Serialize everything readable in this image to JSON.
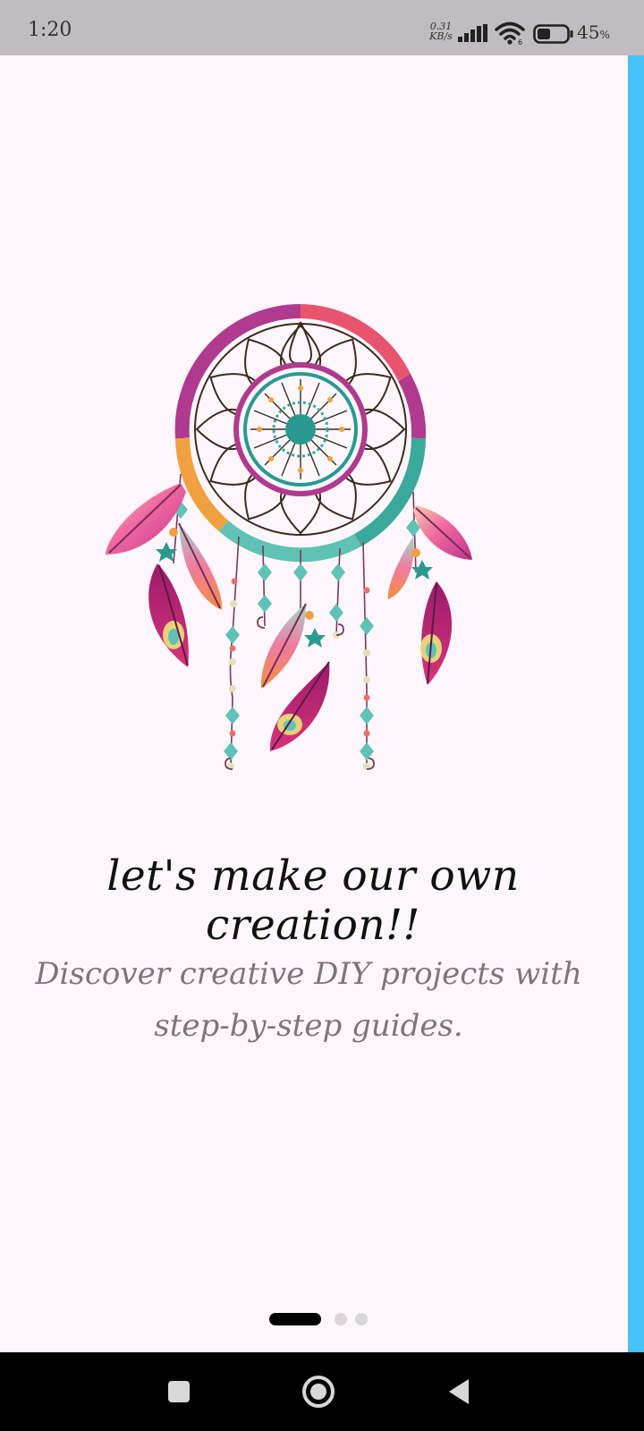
{
  "status_bar": {
    "time": "1:20",
    "net_speed_value": "0.31",
    "net_speed_unit": "KB/s",
    "battery_pct": "45",
    "battery_pct_suffix": "%",
    "battery_level": 0.45
  },
  "onboarding": {
    "headline": "let's make our own creation!!",
    "subtitle_line1": "Discover creative DIY projects with",
    "subtitle_line2": "step-by-step guides.",
    "illustration": "dreamcatcher-illustration",
    "page_count": 3,
    "active_page": 1
  },
  "nav_bar": {
    "recents": "square-icon",
    "home": "circle-icon",
    "back": "triangle-back-icon"
  },
  "colors": {
    "background": "#fdf7fc",
    "status_bar": "#c1bcc0",
    "edge_strip": "#45c2f6",
    "headline": "#111111",
    "subtitle": "#7b7679",
    "pager_active": "#000000",
    "pager_inactive": "#d9d6d9"
  }
}
